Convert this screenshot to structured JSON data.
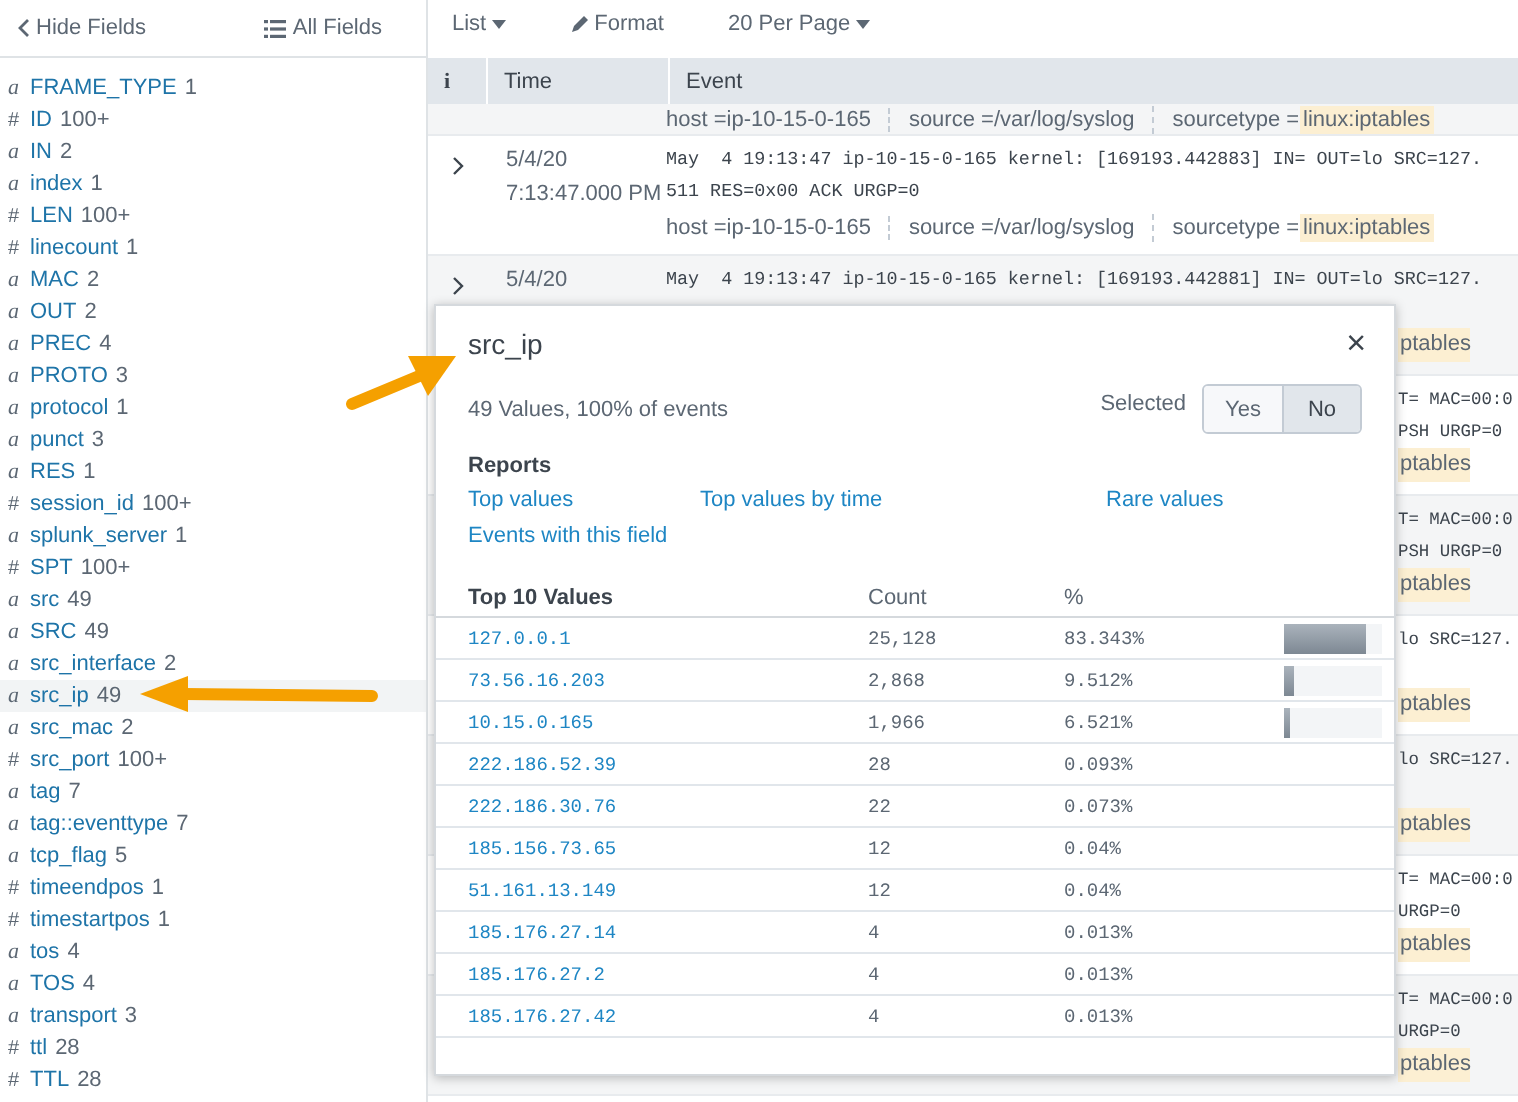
{
  "sidebar": {
    "hide_fields": "Hide Fields",
    "all_fields": "All Fields",
    "fields": [
      {
        "type": "a",
        "name": "FRAME_TYPE",
        "count": "1",
        "selected": false
      },
      {
        "type": "#",
        "name": "ID",
        "count": "100+",
        "selected": false
      },
      {
        "type": "a",
        "name": "IN",
        "count": "2",
        "selected": false
      },
      {
        "type": "a",
        "name": "index",
        "count": "1",
        "selected": false
      },
      {
        "type": "#",
        "name": "LEN",
        "count": "100+",
        "selected": false
      },
      {
        "type": "#",
        "name": "linecount",
        "count": "1",
        "selected": false
      },
      {
        "type": "a",
        "name": "MAC",
        "count": "2",
        "selected": false
      },
      {
        "type": "a",
        "name": "OUT",
        "count": "2",
        "selected": false
      },
      {
        "type": "a",
        "name": "PREC",
        "count": "4",
        "selected": false
      },
      {
        "type": "a",
        "name": "PROTO",
        "count": "3",
        "selected": false
      },
      {
        "type": "a",
        "name": "protocol",
        "count": "1",
        "selected": false
      },
      {
        "type": "a",
        "name": "punct",
        "count": "3",
        "selected": false
      },
      {
        "type": "a",
        "name": "RES",
        "count": "1",
        "selected": false
      },
      {
        "type": "#",
        "name": "session_id",
        "count": "100+",
        "selected": false
      },
      {
        "type": "a",
        "name": "splunk_server",
        "count": "1",
        "selected": false
      },
      {
        "type": "#",
        "name": "SPT",
        "count": "100+",
        "selected": false
      },
      {
        "type": "a",
        "name": "src",
        "count": "49",
        "selected": false
      },
      {
        "type": "a",
        "name": "SRC",
        "count": "49",
        "selected": false
      },
      {
        "type": "a",
        "name": "src_interface",
        "count": "2",
        "selected": false
      },
      {
        "type": "a",
        "name": "src_ip",
        "count": "49",
        "selected": true
      },
      {
        "type": "a",
        "name": "src_mac",
        "count": "2",
        "selected": false
      },
      {
        "type": "#",
        "name": "src_port",
        "count": "100+",
        "selected": false
      },
      {
        "type": "a",
        "name": "tag",
        "count": "7",
        "selected": false
      },
      {
        "type": "a",
        "name": "tag::eventtype",
        "count": "7",
        "selected": false
      },
      {
        "type": "a",
        "name": "tcp_flag",
        "count": "5",
        "selected": false
      },
      {
        "type": "#",
        "name": "timeendpos",
        "count": "1",
        "selected": false
      },
      {
        "type": "#",
        "name": "timestartpos",
        "count": "1",
        "selected": false
      },
      {
        "type": "a",
        "name": "tos",
        "count": "4",
        "selected": false
      },
      {
        "type": "a",
        "name": "TOS",
        "count": "4",
        "selected": false
      },
      {
        "type": "a",
        "name": "transport",
        "count": "3",
        "selected": false
      },
      {
        "type": "#",
        "name": "ttl",
        "count": "28",
        "selected": false
      },
      {
        "type": "#",
        "name": "TTL",
        "count": "28",
        "selected": false
      }
    ]
  },
  "toolbar": [
    {
      "label": "List",
      "kind": "dropdown"
    },
    {
      "label": "Format",
      "kind": "format"
    },
    {
      "label": "20 Per Page",
      "kind": "dropdown"
    }
  ],
  "events": {
    "columns": [
      "i",
      "Time",
      "Event"
    ],
    "rows": [
      {
        "meta": [
          {
            "key": "host = ",
            "value": "ip-10-15-0-165"
          },
          {
            "key": "source = ",
            "value": "/var/log/syslog"
          },
          {
            "key": "sourcetype = ",
            "value": "linux:iptables",
            "tag": true
          }
        ]
      },
      {
        "date": "5/4/20",
        "time": "7:13:47.000 PM",
        "lines": [
          "May  4 19:13:47 ip-10-15-0-165 kernel: [169193.442883] IN= OUT=lo SRC=127.",
          "511 RES=0x00 ACK URGP=0"
        ],
        "meta": [
          {
            "key": "host = ",
            "value": "ip-10-15-0-165"
          },
          {
            "key": "source = ",
            "value": "/var/log/syslog"
          },
          {
            "key": "sourcetype = ",
            "value": "linux:iptables",
            "tag": true
          }
        ]
      },
      {
        "date": "5/4/20",
        "lines": [
          "May  4 19:13:47 ip-10-15-0-165 kernel: [169193.442881] IN= OUT=lo SRC=127."
        ],
        "fragments": [
          {
            "text": "ptables",
            "kind": "tag"
          }
        ]
      },
      {
        "fragments": [
          {
            "text": "T= MAC=00:0",
            "kind": "code"
          },
          {
            "text": "PSH URGP=0",
            "kind": "code"
          },
          {
            "text": "ptables",
            "kind": "tag"
          }
        ]
      },
      {
        "fragments": [
          {
            "text": "T= MAC=00:0",
            "kind": "code"
          },
          {
            "text": "PSH URGP=0",
            "kind": "code"
          },
          {
            "text": "ptables",
            "kind": "tag"
          }
        ]
      },
      {
        "fragments": [
          {
            "text": "lo SRC=127.",
            "kind": "code"
          },
          {
            "text": "ptables",
            "kind": "tag"
          }
        ]
      },
      {
        "fragments": [
          {
            "text": "lo SRC=127.",
            "kind": "code"
          },
          {
            "text": "ptables",
            "kind": "tag"
          }
        ]
      },
      {
        "fragments": [
          {
            "text": "T= MAC=00:0",
            "kind": "code"
          },
          {
            "text": "URGP=0",
            "kind": "code"
          },
          {
            "text": "ptables",
            "kind": "tag"
          }
        ]
      },
      {
        "fragments": [
          {
            "text": "T= MAC=00:0",
            "kind": "code"
          },
          {
            "text": "URGP=0",
            "kind": "code"
          },
          {
            "text": "ptables",
            "kind": "tag"
          }
        ]
      }
    ]
  },
  "popup": {
    "title": "src_ip",
    "close": "×",
    "summary": "49 Values, 100% of events",
    "selected_label": "Selected",
    "toggle": [
      {
        "label": "Yes",
        "selected": false
      },
      {
        "label": "No",
        "selected": true
      }
    ],
    "reports_heading": "Reports",
    "reports": [
      "Top values",
      "Top values by time",
      "Rare values",
      "Events with this field"
    ],
    "columns": [
      "Top 10 Values",
      "Count",
      "%"
    ],
    "values": [
      {
        "value": "127.0.0.1",
        "count": "25,128",
        "percent": "83.343%",
        "level": 0.83343
      },
      {
        "value": "73.56.16.203",
        "count": "2,868",
        "percent": "9.512%",
        "level": 0.09512
      },
      {
        "value": "10.15.0.165",
        "count": "1,966",
        "percent": "6.521%",
        "level": 0.06521
      },
      {
        "value": "222.186.52.39",
        "count": "28",
        "percent": "0.093%"
      },
      {
        "value": "222.186.30.76",
        "count": "22",
        "percent": "0.073%"
      },
      {
        "value": "185.156.73.65",
        "count": "12",
        "percent": "0.04%"
      },
      {
        "value": "51.161.13.149",
        "count": "12",
        "percent": "0.04%"
      },
      {
        "value": "185.176.27.14",
        "count": "4",
        "percent": "0.013%"
      },
      {
        "value": "185.176.27.2",
        "count": "4",
        "percent": "0.013%"
      },
      {
        "value": "185.176.27.42",
        "count": "4",
        "percent": "0.013%"
      }
    ]
  }
}
